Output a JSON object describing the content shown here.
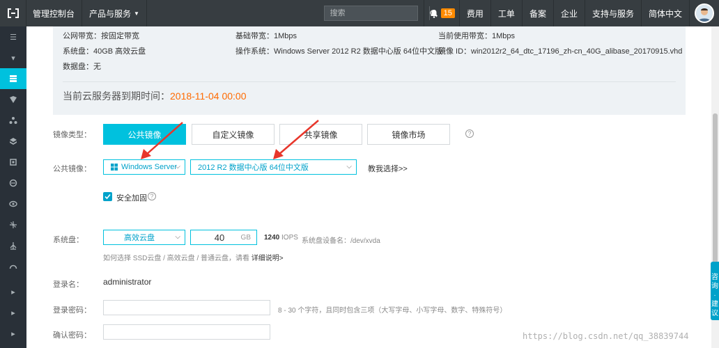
{
  "topbar": {
    "console": "管理控制台",
    "products": "产品与服务",
    "search_placeholder": "搜索",
    "notifications": "15",
    "nav": [
      "费用",
      "工单",
      "备案",
      "企业",
      "支持与服务",
      "简体中文"
    ]
  },
  "info": {
    "bandwidth_public": "公网带宽：按固定带宽",
    "bandwidth_base": "基础带宽：1Mbps",
    "bandwidth_current": "当前使用带宽：1Mbps",
    "system_disk": "系统盘：40GB 高效云盘",
    "os": "操作系统：Windows Server 2012 R2 数据中心版 64位中文版",
    "image_id": "镜像 ID：win2012r2_64_dtc_17196_zh-cn_40G_alibase_20170915.vhd",
    "data_disk": "数据盘：无",
    "expire_label": "当前云服务器到期时间：",
    "expire_date": "2018-11-04 00:00"
  },
  "form": {
    "image_type_label": "镜像类型：",
    "tabs": [
      "公共镜像",
      "自定义镜像",
      "共享镜像",
      "镜像市场"
    ],
    "public_image_label": "公共镜像：",
    "os_select": "Windows Server",
    "version_select": "2012 R2 数据中心版 64位中文版",
    "choose_link": "教我选择>>",
    "security_label": "安全加固",
    "system_disk_label": "系统盘：",
    "disk_type": "高效云盘",
    "disk_size": "40",
    "disk_unit": "GB",
    "iops_value": "1240",
    "iops_unit": "IOPS",
    "device_name": "系统盘设备名：/dev/xvda",
    "disk_hint": "如何选择 SSD云盘 / 高效云盘 / 普通云盘，请看",
    "disk_hint_link": "详细说明>",
    "login_label": "登录名：",
    "login_value": "administrator",
    "password_label": "登录密码：",
    "password_hint": "8 - 30 个字符，且同时包含三项（大写字母、小写字母、数字、特殊符号）",
    "confirm_label": "确认密码："
  },
  "consult_text": "咨询·建议",
  "watermark": "https://blog.csdn.net/qq_38839744",
  "colors": {
    "accent": "#00c1de",
    "orange": "#ff6a00",
    "topbar": "#373d41",
    "sidebar": "#293038"
  }
}
